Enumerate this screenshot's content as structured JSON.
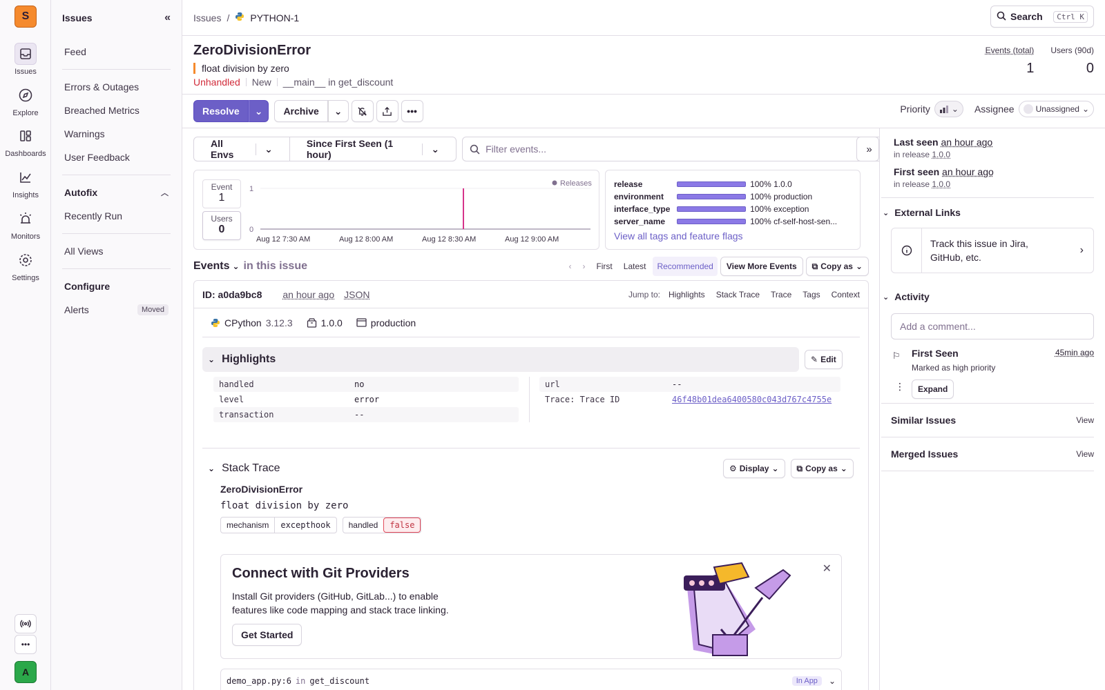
{
  "org_initial": "S",
  "user_initial": "A",
  "rail": [
    {
      "label": "Issues",
      "icon": "inbox-icon"
    },
    {
      "label": "Explore",
      "icon": "compass-icon"
    },
    {
      "label": "Dashboards",
      "icon": "dashboard-icon"
    },
    {
      "label": "Insights",
      "icon": "chart-icon"
    },
    {
      "label": "Monitors",
      "icon": "siren-icon"
    },
    {
      "label": "Settings",
      "icon": "gear-icon"
    }
  ],
  "subnav": {
    "title": "Issues",
    "feed": "Feed",
    "items": [
      "Errors & Outages",
      "Breached Metrics",
      "Warnings",
      "User Feedback"
    ],
    "autofix": "Autofix",
    "recently_run": "Recently Run",
    "all_views": "All Views",
    "configure": "Configure",
    "alerts": "Alerts",
    "moved": "Moved"
  },
  "breadcrumb": {
    "root": "Issues",
    "sep": "/",
    "current": "PYTHON-1"
  },
  "search": {
    "label": "Search",
    "shortcut": "Ctrl K"
  },
  "issue": {
    "title": "ZeroDivisionError",
    "message": "float division by zero",
    "status": "Unhandled",
    "substatus": "New",
    "culprit": "__main__ in get_discount"
  },
  "stats": {
    "events_label": "Events (total)",
    "events": "1",
    "users_label": "Users (90d)",
    "users": "0"
  },
  "actions": {
    "resolve": "Resolve",
    "archive": "Archive",
    "priority": "Priority",
    "assignee": "Assignee",
    "unassigned": "Unassigned"
  },
  "filters": {
    "env": "All Envs",
    "range": "Since First Seen (1 hour)",
    "placeholder": "Filter events..."
  },
  "graph": {
    "event_label": "Event",
    "event_value": "1",
    "users_label": "Users",
    "users_value": "0",
    "y_top": "1",
    "y_bottom": "0",
    "legend": "Releases",
    "ticks": [
      "Aug 12 7:30 AM",
      "Aug 12 8:00 AM",
      "Aug 12 8:30 AM",
      "Aug 12 9:00 AM"
    ]
  },
  "chart_data": {
    "type": "bar",
    "title": "",
    "x_ticks": [
      "Aug 12 7:30 AM",
      "Aug 12 8:00 AM",
      "Aug 12 8:30 AM",
      "Aug 12 9:00 AM"
    ],
    "ylim": [
      0,
      1
    ],
    "series": [
      {
        "values": [
          {
            "x": "Aug 12 8:39 AM",
            "y": 1
          }
        ]
      }
    ],
    "legend": [
      "Releases"
    ],
    "legend_position": "top-right"
  },
  "tags": [
    {
      "key": "release",
      "value": "100% 1.0.0"
    },
    {
      "key": "environment",
      "value": "100% production"
    },
    {
      "key": "interface_type",
      "value": "100% exception"
    },
    {
      "key": "server_name",
      "value": "100% cf-self-host-sen..."
    }
  ],
  "tags_link": "View all tags and feature flags",
  "events_nav": {
    "title": "Events",
    "subtitle": "in this issue",
    "first": "First",
    "latest": "Latest",
    "recommended": "Recommended",
    "view_more": "View More Events",
    "copy_as": "Copy as"
  },
  "event": {
    "id": "ID: a0da9bc8",
    "time": "an hour ago",
    "json": "JSON",
    "jump_label": "Jump to:",
    "jump": [
      "Highlights",
      "Stack Trace",
      "Trace",
      "Tags",
      "Context"
    ],
    "runtime": "CPython",
    "runtime_version": "3.12.3",
    "release": "1.0.0",
    "environment": "production"
  },
  "highlights": {
    "title": "Highlights",
    "edit": "Edit",
    "left": [
      {
        "k": "handled",
        "v": "no"
      },
      {
        "k": "level",
        "v": "error"
      },
      {
        "k": "transaction",
        "v": "--"
      }
    ],
    "right": [
      {
        "k": "url",
        "v": "--"
      },
      {
        "k": "Trace: Trace ID",
        "v": "46f48b01dea6400580c043d767c4755e"
      }
    ]
  },
  "stacktrace": {
    "title": "Stack Trace",
    "display": "Display",
    "copy_as": "Copy as",
    "exc_type": "ZeroDivisionError",
    "exc_value": "float division by zero",
    "mech_k": "mechanism",
    "mech_v": "excepthook",
    "handled_k": "handled",
    "handled_v": "false"
  },
  "promo": {
    "title": "Connect with Git Providers",
    "body1": "Install Git providers (GitHub, GitLab...) to enable",
    "body2": "features like code mapping and stack trace linking.",
    "cta": "Get Started"
  },
  "frame": {
    "file": "demo_app.py:6",
    "in": "in",
    "fn": "get_discount",
    "badge": "In App"
  },
  "side": {
    "last_seen": "Last seen",
    "last_seen_v": "an hour ago",
    "first_seen": "First seen",
    "first_seen_v": "an hour ago",
    "in_release": "in release",
    "release": "1.0.0",
    "external_links": "External Links",
    "jira": "Track this issue in Jira, GitHub, etc.",
    "activity": "Activity",
    "comment_placeholder": "Add a comment...",
    "act_title": "First Seen",
    "act_time": "45min ago",
    "act_desc": "Marked as high priority",
    "expand": "Expand",
    "similar": "Similar Issues",
    "merged": "Merged Issues",
    "view": "View"
  },
  "colors": {
    "accent": "#6c5fc7",
    "error": "#d12b3a",
    "orange": "#f58a2d",
    "release_line": "#d6338a"
  }
}
